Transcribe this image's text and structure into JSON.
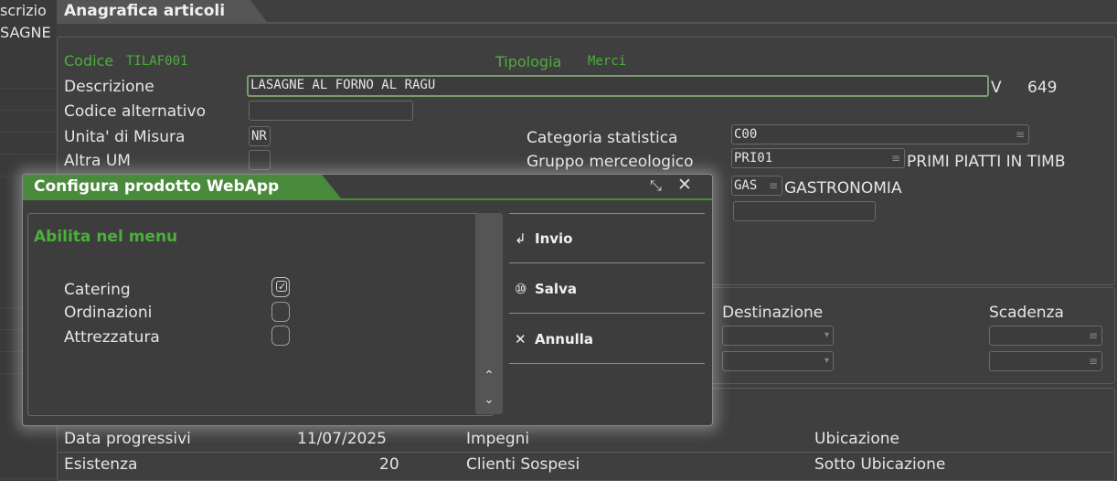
{
  "left_strip": {
    "line1": "scrizio",
    "line2": "SAGNE"
  },
  "main_tab": {
    "title": "Anagrafica articoli"
  },
  "form": {
    "codice_label": "Codice",
    "codice_value": "TILAF001",
    "tipologia_label": "Tipologia",
    "tipologia_value": "Merci",
    "descrizione_label": "Descrizione",
    "descrizione_value": "LASAGNE AL FORNO AL RAGU",
    "descrizione_suffix": "V",
    "descrizione_number": "649",
    "codice_alt_label": "Codice alternativo",
    "codice_alt_value": "",
    "um_label": "Unita' di Misura",
    "um_value": "NR",
    "altra_um_label": "Altra UM",
    "cat_stat_label": "Categoria statistica",
    "cat_stat_value": "C00",
    "gruppo_label": "Gruppo merceologico",
    "gruppo_value": "PRI01",
    "gruppo_desc": "PRIMI PIATTI IN TIMB",
    "gas_value": "GAS",
    "gas_desc": "GASTRONOMIA"
  },
  "mid_panel": {
    "destinazione_label": "Destinazione",
    "scadenza_label": "Scadenza"
  },
  "bottom_panel": {
    "data_prog_label": "Data progressivi",
    "data_prog_value": "11/07/2025",
    "impegni_label": "Impegni",
    "ubicazione_label": "Ubicazione",
    "esistenza_label": "Esistenza",
    "esistenza_value": "20",
    "clienti_label": "Clienti Sospesi",
    "sotto_ubic_label": "Sotto Ubicazione"
  },
  "dialog": {
    "title": "Configura prodotto WebApp",
    "section_title": "Abilita nel menu",
    "options": [
      {
        "label": "Catering",
        "checked": true
      },
      {
        "label": "Ordinazioni",
        "checked": false
      },
      {
        "label": "Attrezzatura",
        "checked": false
      }
    ],
    "actions": [
      {
        "icon": "↲",
        "label": "Invio"
      },
      {
        "icon": "⑩",
        "label": "Salva"
      },
      {
        "icon": "✕",
        "label": "Annulla"
      }
    ]
  },
  "colors": {
    "accent_green": "#4caf3c",
    "dialog_green": "#4a8a3c",
    "background": "#3f3f3f"
  }
}
